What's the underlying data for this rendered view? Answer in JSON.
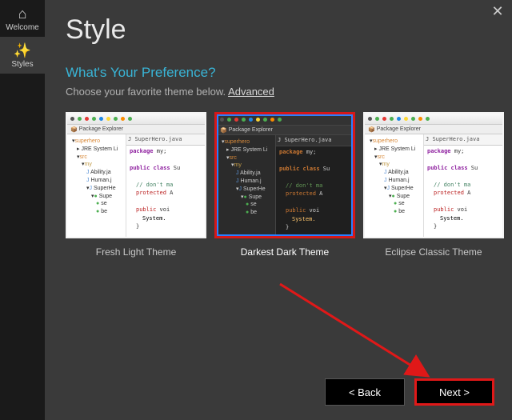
{
  "window": {
    "close_glyph": "✕"
  },
  "sidebar": {
    "items": [
      {
        "icon": "⌂",
        "label": "Welcome",
        "active": false
      },
      {
        "icon": "✨",
        "label": "Styles",
        "active": true
      }
    ]
  },
  "header": {
    "title": "Style",
    "subtitle": "What's Your Preference?",
    "description": "Choose your favorite theme below. ",
    "advanced_label": "Advanced"
  },
  "themes": [
    {
      "label": "Fresh Light Theme",
      "selected": false,
      "variant": "light"
    },
    {
      "label": "Darkest Dark Theme",
      "selected": true,
      "variant": "dark"
    },
    {
      "label": "Eclipse Classic Theme",
      "selected": false,
      "variant": "light"
    }
  ],
  "preview": {
    "explorer_title": "Package Explorer",
    "tab_title": "SuperHero.java",
    "tree": {
      "project": "superhero",
      "jre": "JRE System Li",
      "src": "src",
      "pkg": "my",
      "files": [
        "Ability.ja",
        "Human.j",
        "SuperHe"
      ],
      "sub": [
        "se",
        "be"
      ]
    },
    "code": {
      "l1_kw": "package",
      "l1_rest": " my;",
      "l2_kw": "public class",
      "l2_rest": " Su",
      "l3_cm": "// don't ma",
      "l4_kw": "protected",
      "l4_rest": " A",
      "l5_kw": "public",
      "l5_rest": " voi",
      "l6_sys": "System.",
      "l7": "}"
    }
  },
  "footer": {
    "back_label": "< Back",
    "next_label": "Next >"
  }
}
